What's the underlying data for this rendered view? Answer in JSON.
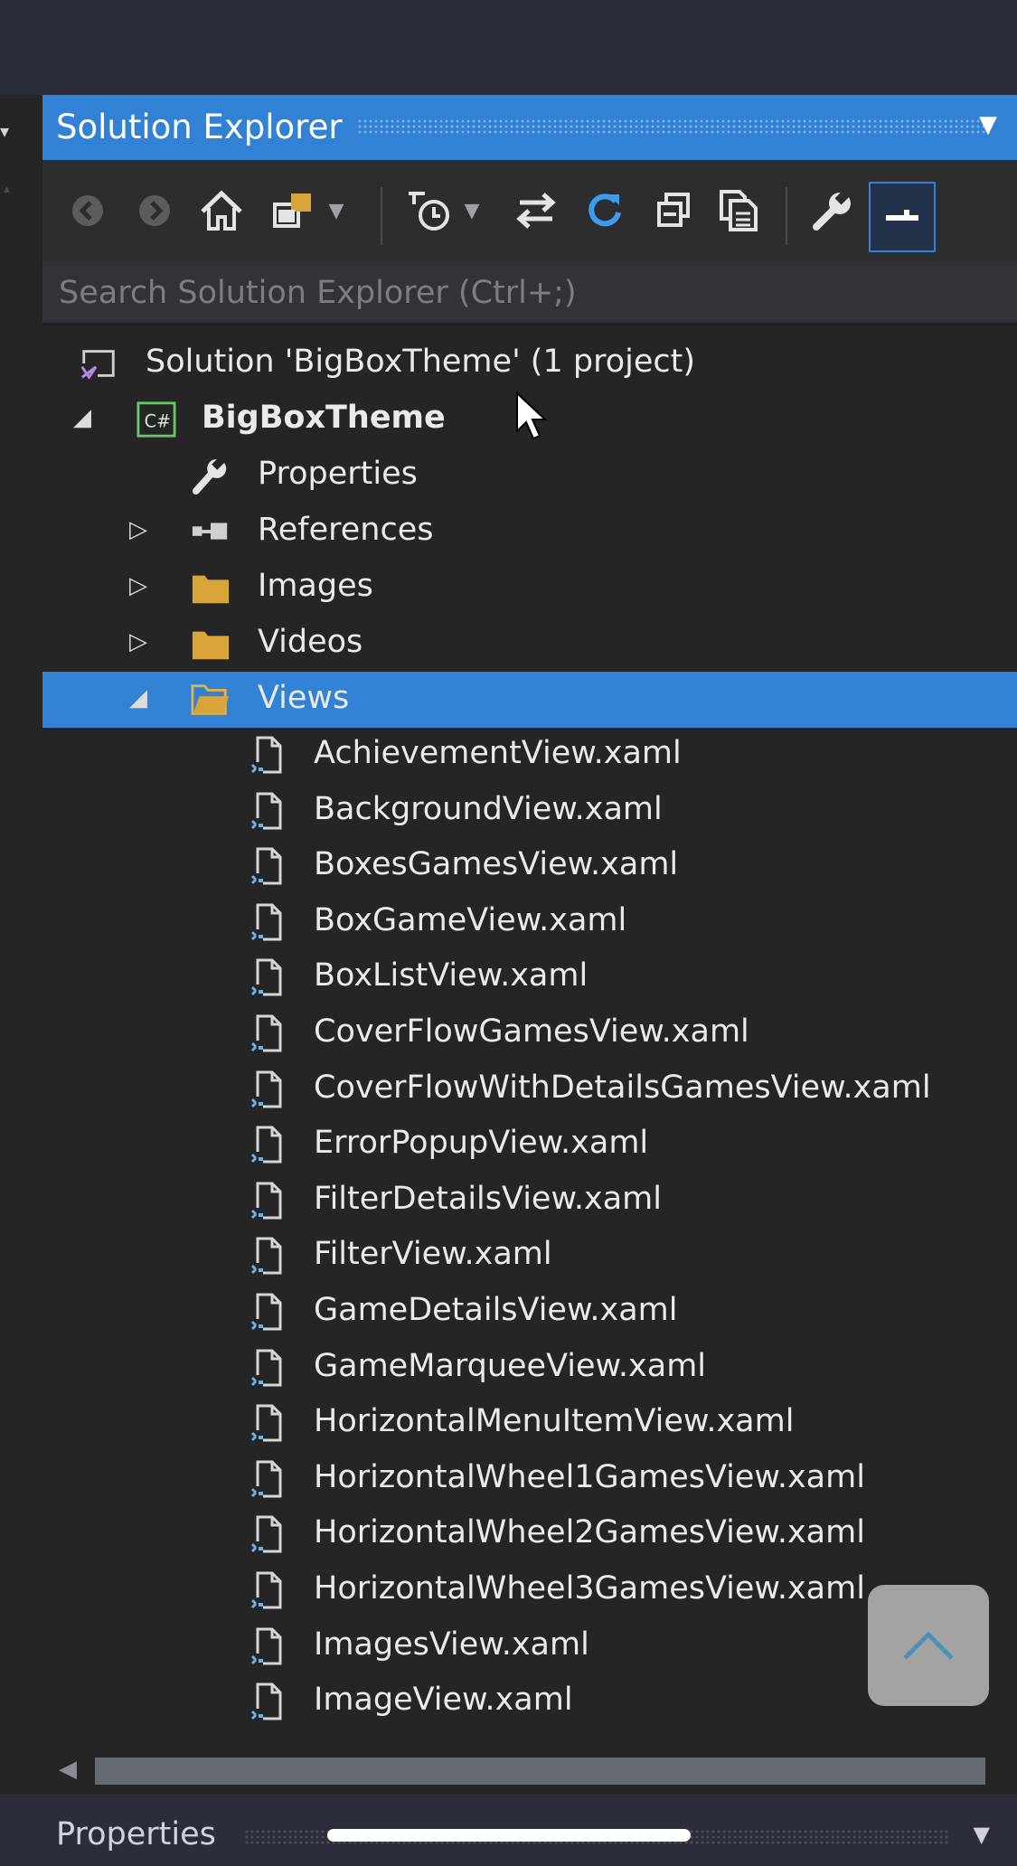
{
  "panel": {
    "title": "Solution Explorer",
    "search_placeholder": "Search Solution Explorer (Ctrl+;)"
  },
  "toolbar": {
    "buttons": [
      {
        "name": "back-button",
        "icon": "arrow-left-circle-icon",
        "enabled": false
      },
      {
        "name": "forward-button",
        "icon": "arrow-right-circle-icon",
        "enabled": false
      },
      {
        "name": "home-button",
        "icon": "home-icon",
        "enabled": true
      },
      {
        "name": "switch-views-button",
        "icon": "switch-views-icon",
        "enabled": true
      },
      {
        "name": "pending-changes-filter-button",
        "icon": "clock-filter-icon",
        "enabled": true
      },
      {
        "name": "sync-active-document-button",
        "icon": "sync-arrows-icon",
        "enabled": true
      },
      {
        "name": "refresh-button",
        "icon": "refresh-icon",
        "enabled": true,
        "color": "#3b9cf0"
      },
      {
        "name": "collapse-all-button",
        "icon": "collapse-all-icon",
        "enabled": true
      },
      {
        "name": "show-all-files-button",
        "icon": "show-all-files-icon",
        "enabled": true
      },
      {
        "name": "properties-button",
        "icon": "wrench-icon",
        "enabled": true
      },
      {
        "name": "preview-selected-items-button",
        "icon": "preview-toggle-icon",
        "enabled": true,
        "active": true
      }
    ]
  },
  "tree": {
    "solution": {
      "label": "Solution 'BigBoxTheme' (1 project)",
      "icon": "solution-icon"
    },
    "project": {
      "label": "BigBoxTheme",
      "icon": "csharp-project-icon",
      "expanded": true
    },
    "nodes": [
      {
        "label": "Properties",
        "icon": "wrench-icon",
        "expandable": false
      },
      {
        "label": "References",
        "icon": "references-icon",
        "expandable": true,
        "expanded": false
      },
      {
        "label": "Images",
        "icon": "folder-icon",
        "expandable": true,
        "expanded": false
      },
      {
        "label": "Videos",
        "icon": "folder-icon",
        "expandable": true,
        "expanded": false
      },
      {
        "label": "Views",
        "icon": "folder-open-icon",
        "expandable": true,
        "expanded": true,
        "selected": true
      }
    ],
    "view_files": [
      "AchievementView.xaml",
      "BackgroundView.xaml",
      "BoxesGamesView.xaml",
      "BoxGameView.xaml",
      "BoxListView.xaml",
      "CoverFlowGamesView.xaml",
      "CoverFlowWithDetailsGamesView.xaml",
      "ErrorPopupView.xaml",
      "FilterDetailsView.xaml",
      "FilterView.xaml",
      "GameDetailsView.xaml",
      "GameMarqueeView.xaml",
      "HorizontalMenuItemView.xaml",
      "HorizontalWheel1GamesView.xaml",
      "HorizontalWheel2GamesView.xaml",
      "HorizontalWheel3GamesView.xaml",
      "ImagesView.xaml",
      "ImageView.xaml"
    ]
  },
  "bottom_panel": {
    "title": "Properties"
  },
  "colors": {
    "accent": "#3182d4",
    "tree_background": "#252526",
    "outer_background": "#2b2d3b",
    "text": "#eaeaea",
    "refresh_icon": "#3b9cf0"
  }
}
